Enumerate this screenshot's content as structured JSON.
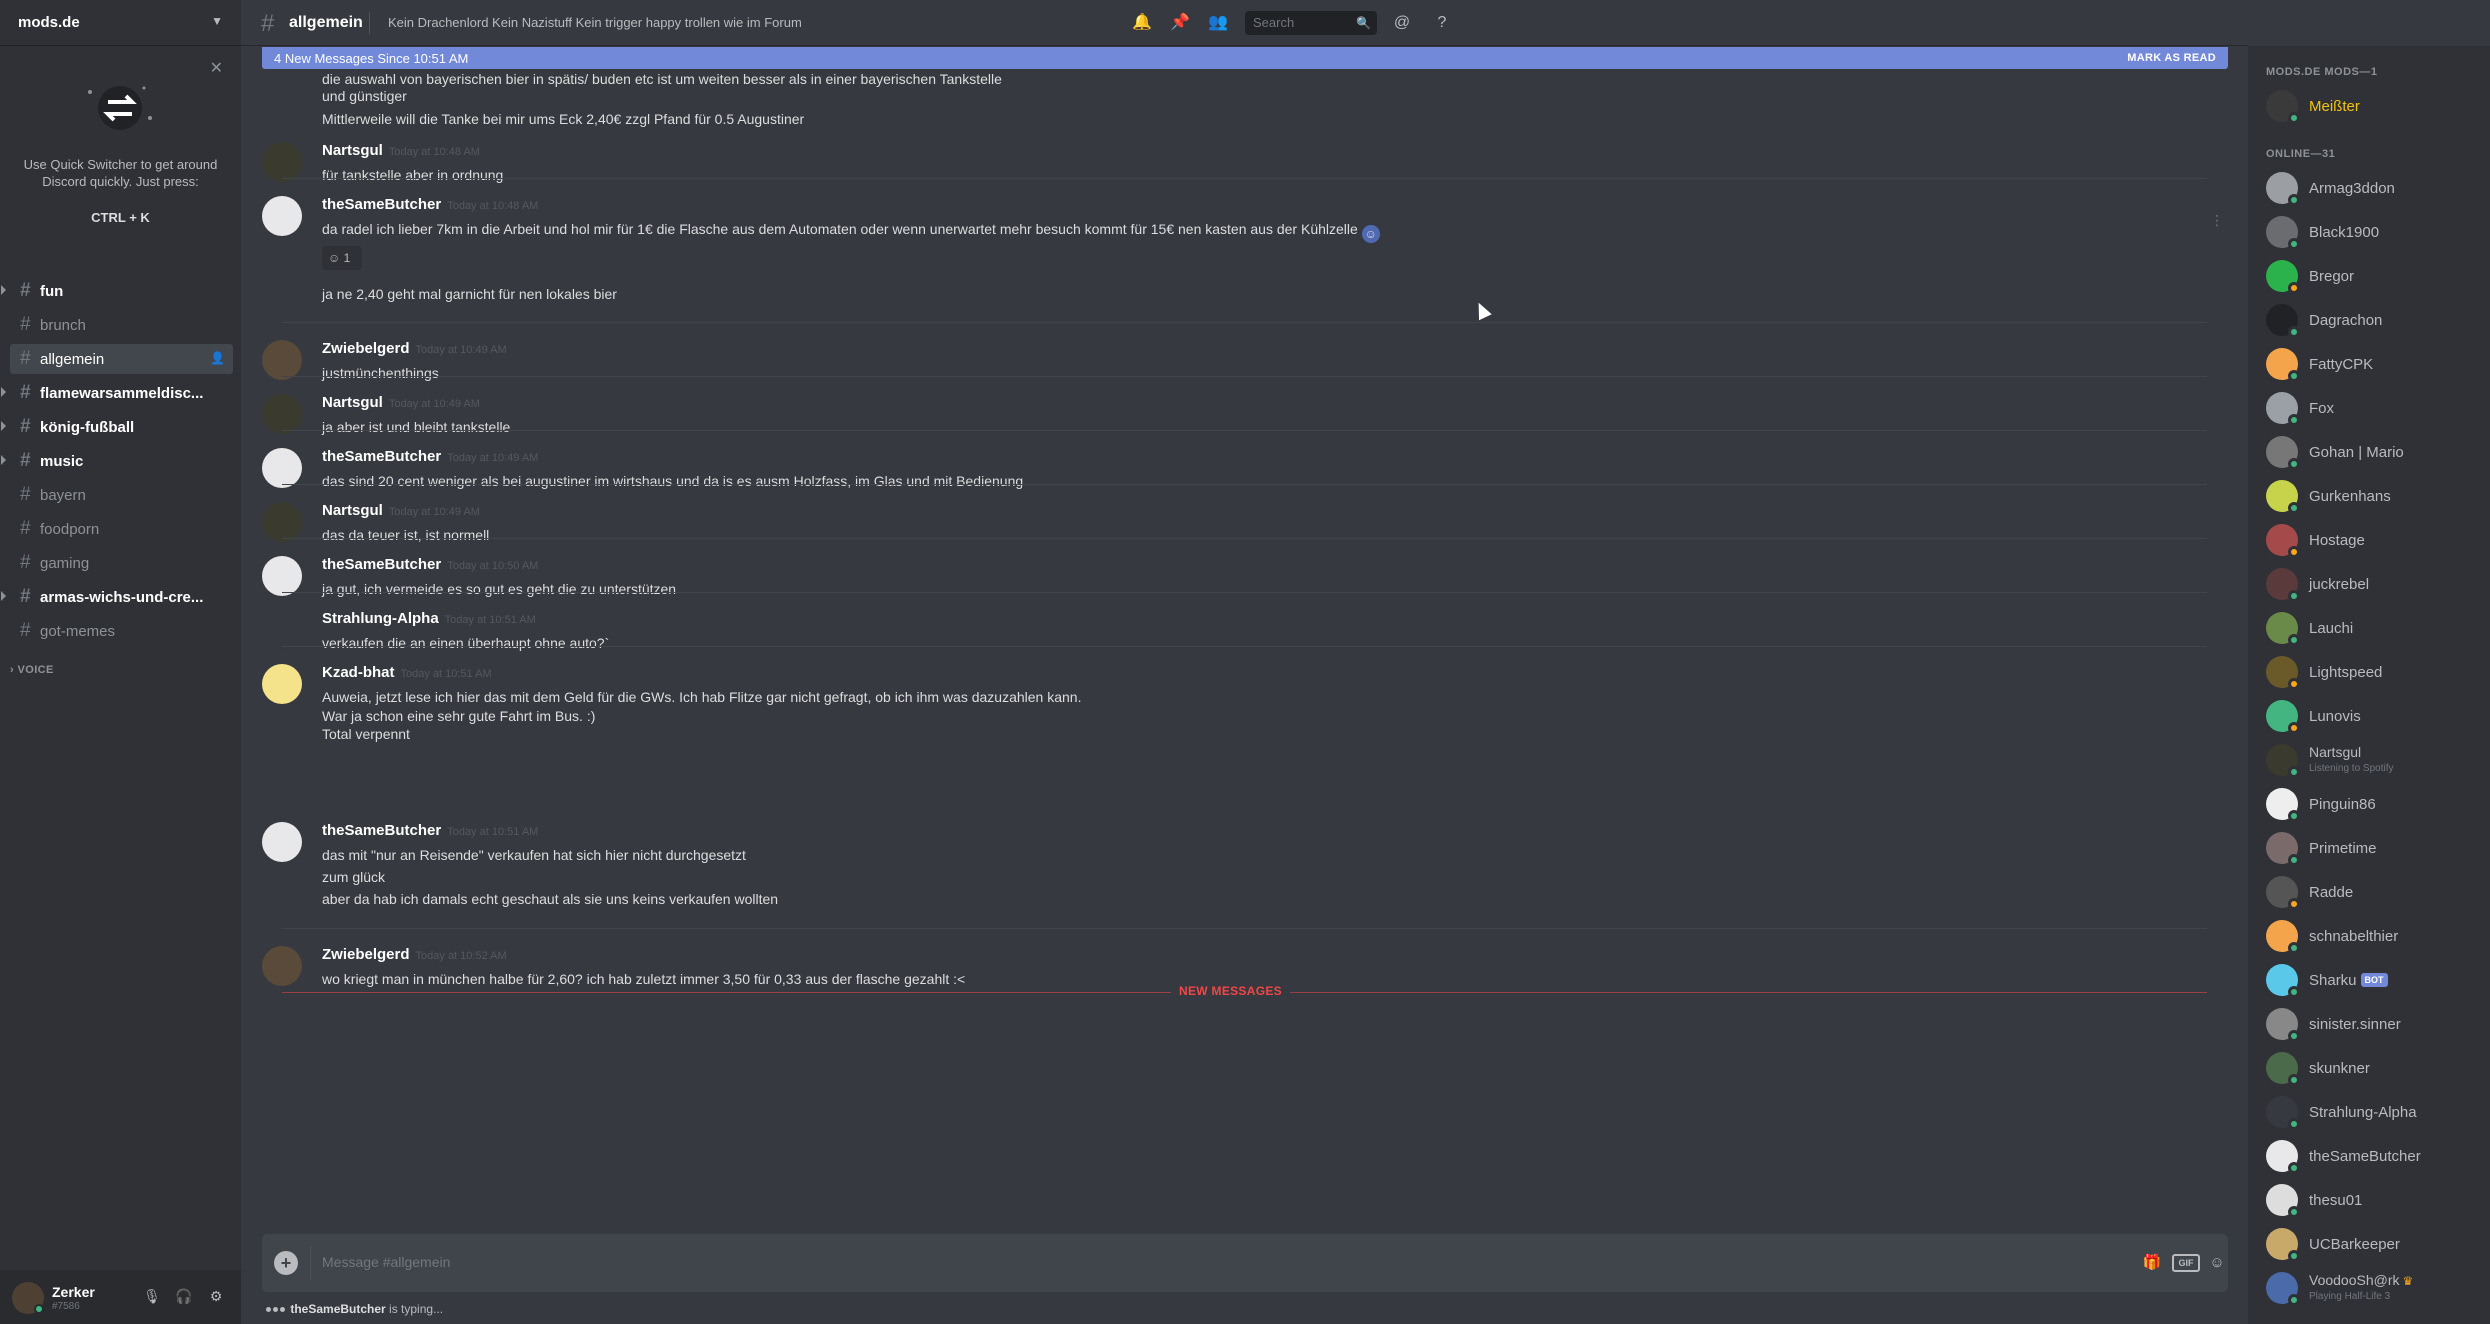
{
  "guild": {
    "name": "mods.de"
  },
  "quick_switcher": {
    "text": "Use Quick Switcher to get around Discord quickly. Just press:",
    "shortcut": "CTRL + K"
  },
  "channels": [
    {
      "name": "fun",
      "state": "unread"
    },
    {
      "name": "brunch",
      "state": "read"
    },
    {
      "name": "allgemein",
      "state": "selected"
    },
    {
      "name": "flamewarsammeldisc...",
      "state": "unread"
    },
    {
      "name": "könig-fußball",
      "state": "unread"
    },
    {
      "name": "music",
      "state": "unread"
    },
    {
      "name": "bayern",
      "state": "read"
    },
    {
      "name": "foodporn",
      "state": "read"
    },
    {
      "name": "gaming",
      "state": "read"
    },
    {
      "name": "armas-wichs-und-cre...",
      "state": "unread"
    },
    {
      "name": "got-memes",
      "state": "read"
    }
  ],
  "voice_category": "VOICE",
  "user": {
    "name": "Zerker",
    "tag": "#7586"
  },
  "header": {
    "channel": "allgemein",
    "topic": "Kein Drachenlord Kein Nazistuff Kein trigger happy trollen wie im Forum",
    "search_placeholder": "Search"
  },
  "banner": {
    "text": "4 New Messages Since 10:51 AM",
    "action": "MARK AS READ"
  },
  "top_fragment": [
    "die auswahl von bayerischen bier in spätis/ buden etc ist um weiten besser als in einer bayerischen Tankstelle",
    "und günstiger",
    "Mittlerweile will die Tanke bei mir ums Eck 2,40€ zzgl Pfand für 0.5 Augustiner"
  ],
  "messages": [
    {
      "author": "Nartsgul",
      "time": "Today at 10:48 AM",
      "lines": [
        "für tankstelle aber in ordnung"
      ]
    },
    {
      "author": "theSameButcher",
      "time": "Today at 10:48 AM",
      "lines": [
        "da radel ich lieber 7km in die Arbeit und hol mir für 1€ die Flasche aus dem Automaten oder wenn unerwartet mehr besuch kommt für 15€ nen kasten aus der Kühlzelle",
        "ja ne 2,40 geht mal garnicht für nen lokales bier"
      ],
      "reaction_count": "1"
    },
    {
      "author": "Zwiebelgerd",
      "time": "Today at 10:49 AM",
      "lines": [
        "justmünchenthings"
      ]
    },
    {
      "author": "Nartsgul",
      "time": "Today at 10:49 AM",
      "lines": [
        "ja aber ist und bleibt tankstelle"
      ]
    },
    {
      "author": "theSameButcher",
      "time": "Today at 10:49 AM",
      "lines": [
        "das sind 20 cent weniger als bei augustiner im wirtshaus und da is es ausm Holzfass, im Glas und mit Bedienung"
      ]
    },
    {
      "author": "Nartsgul",
      "time": "Today at 10:49 AM",
      "lines": [
        "das da teuer ist, ist normell"
      ]
    },
    {
      "author": "theSameButcher",
      "time": "Today at 10:50 AM",
      "lines": [
        "ja gut, ich vermeide es so gut es geht die zu unterstützen"
      ]
    },
    {
      "author": "Strahlung-Alpha",
      "time": "Today at 10:51 AM",
      "lines": [
        "verkaufen die an einen überhaupt ohne auto?`"
      ]
    },
    {
      "author": "Kzad-bhat",
      "time": "Today at 10:51 AM",
      "lines": [
        "Auweia, jetzt lese ich hier das mit dem Geld für die GWs. Ich hab Flitze gar nicht gefragt, ob ich ihm was dazuzahlen kann.",
        "War ja schon eine sehr gute Fahrt im Bus. :)",
        "Total verpennt"
      ]
    },
    {
      "author": "theSameButcher",
      "time": "Today at 10:51 AM",
      "lines": [
        "das mit \"nur an Reisende\" verkaufen hat sich hier nicht durchgesetzt",
        "zum glück",
        "aber da hab ich damals echt geschaut als sie uns keins verkaufen wollten"
      ]
    },
    {
      "author": "Zwiebelgerd",
      "time": "Today at 10:52 AM",
      "lines": [
        "wo kriegt man in münchen halbe für 2,60? ich hab zuletzt immer 3,50 für 0,33 aus der flasche gezahlt :<"
      ]
    }
  ],
  "new_messages_label": "NEW MESSAGES",
  "composer": {
    "placeholder": "Message #allgemein",
    "gif": "GIF"
  },
  "typing": {
    "user": "theSameButcher",
    "text": " is typing..."
  },
  "members": {
    "mod_category": "MODS.DE MODS—1",
    "online_category": "ONLINE—31",
    "mods": [
      {
        "name": "Meißter",
        "status": "online",
        "color": "#f1c40f"
      }
    ],
    "online": [
      {
        "name": "Armag3ddon",
        "status": "online"
      },
      {
        "name": "Black1900",
        "status": "online"
      },
      {
        "name": "Bregor",
        "status": "idle"
      },
      {
        "name": "Dagrachon",
        "status": "online"
      },
      {
        "name": "FattyCPK",
        "status": "online"
      },
      {
        "name": "Fox",
        "status": "online"
      },
      {
        "name": "Gohan | Mario",
        "status": "online"
      },
      {
        "name": "Gurkenhans",
        "status": "online"
      },
      {
        "name": "Hostage",
        "status": "idle"
      },
      {
        "name": "juckrebel",
        "status": "online"
      },
      {
        "name": "Lauchi",
        "status": "online"
      },
      {
        "name": "Lightspeed",
        "status": "idle"
      },
      {
        "name": "Lunovis",
        "status": "idle"
      },
      {
        "name": "Nartsgul",
        "status": "online",
        "activity": "Listening to Spotify"
      },
      {
        "name": "Pinguin86",
        "status": "online"
      },
      {
        "name": "Primetime",
        "status": "online"
      },
      {
        "name": "Radde",
        "status": "idle"
      },
      {
        "name": "schnabelthier",
        "status": "online"
      },
      {
        "name": "Sharku",
        "status": "online",
        "bot": "BOT"
      },
      {
        "name": "sinister.sinner",
        "status": "online"
      },
      {
        "name": "skunkner",
        "status": "online"
      },
      {
        "name": "Strahlung-Alpha",
        "status": "online"
      },
      {
        "name": "theSameButcher",
        "status": "online"
      },
      {
        "name": "thesu01",
        "status": "online"
      },
      {
        "name": "UCBarkeeper",
        "status": "online"
      },
      {
        "name": "VoodooSh@rk",
        "status": "online",
        "activity": "Playing Half-Life 3"
      }
    ]
  },
  "colors": {
    "accent": "#7289da",
    "online": "#43b581",
    "idle": "#faa61a",
    "new": "#f04747"
  }
}
